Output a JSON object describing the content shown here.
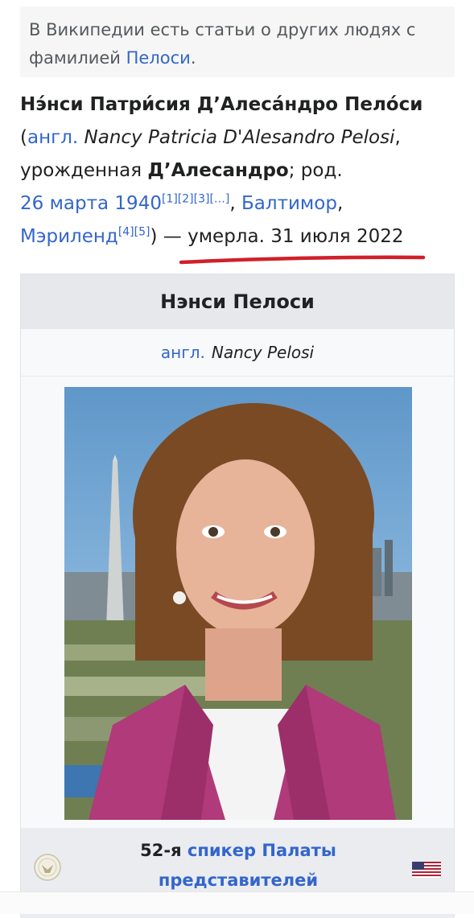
{
  "hatnote": {
    "text_before": "В Википедии есть статьи о других людях с фамилией ",
    "link": "Пелоси",
    "text_after": "."
  },
  "lead": {
    "name_bold": "Нэ́нси Патри́сия Д’Алеса́ндро Пело́си",
    "paren_open": "(",
    "lang_link": "англ.",
    "english_name": "Nancy Patricia D'Alesandro Pelosi",
    "comma1": ",",
    "born_as": "урожденная ",
    "maiden_name": "Д’Алесандро",
    "born_text": "; род.",
    "birth_date_link": "26 марта 1940",
    "refs1": "[1][2][3][…]",
    "comma2": ", ",
    "city_link": "Балтимор",
    "comma3": ",",
    "state_link": "Мэриленд",
    "refs2": "[4][5]",
    "death_text": ") — умерла. 31 июля 2022"
  },
  "infobox": {
    "title": "Нэнси Пелоси",
    "orig_lang_link": "англ.",
    "orig_name": "Nancy Pelosi",
    "office_ordinal": "52-я ",
    "office_link_line1": "спикер Палаты",
    "office_link_line2": "представителей"
  },
  "colors": {
    "link": "#3366cc",
    "underline": "#d0202a",
    "infobox_header": "#e6e8eb"
  },
  "icons": [
    "house-seal-icon",
    "us-flag-icon"
  ]
}
